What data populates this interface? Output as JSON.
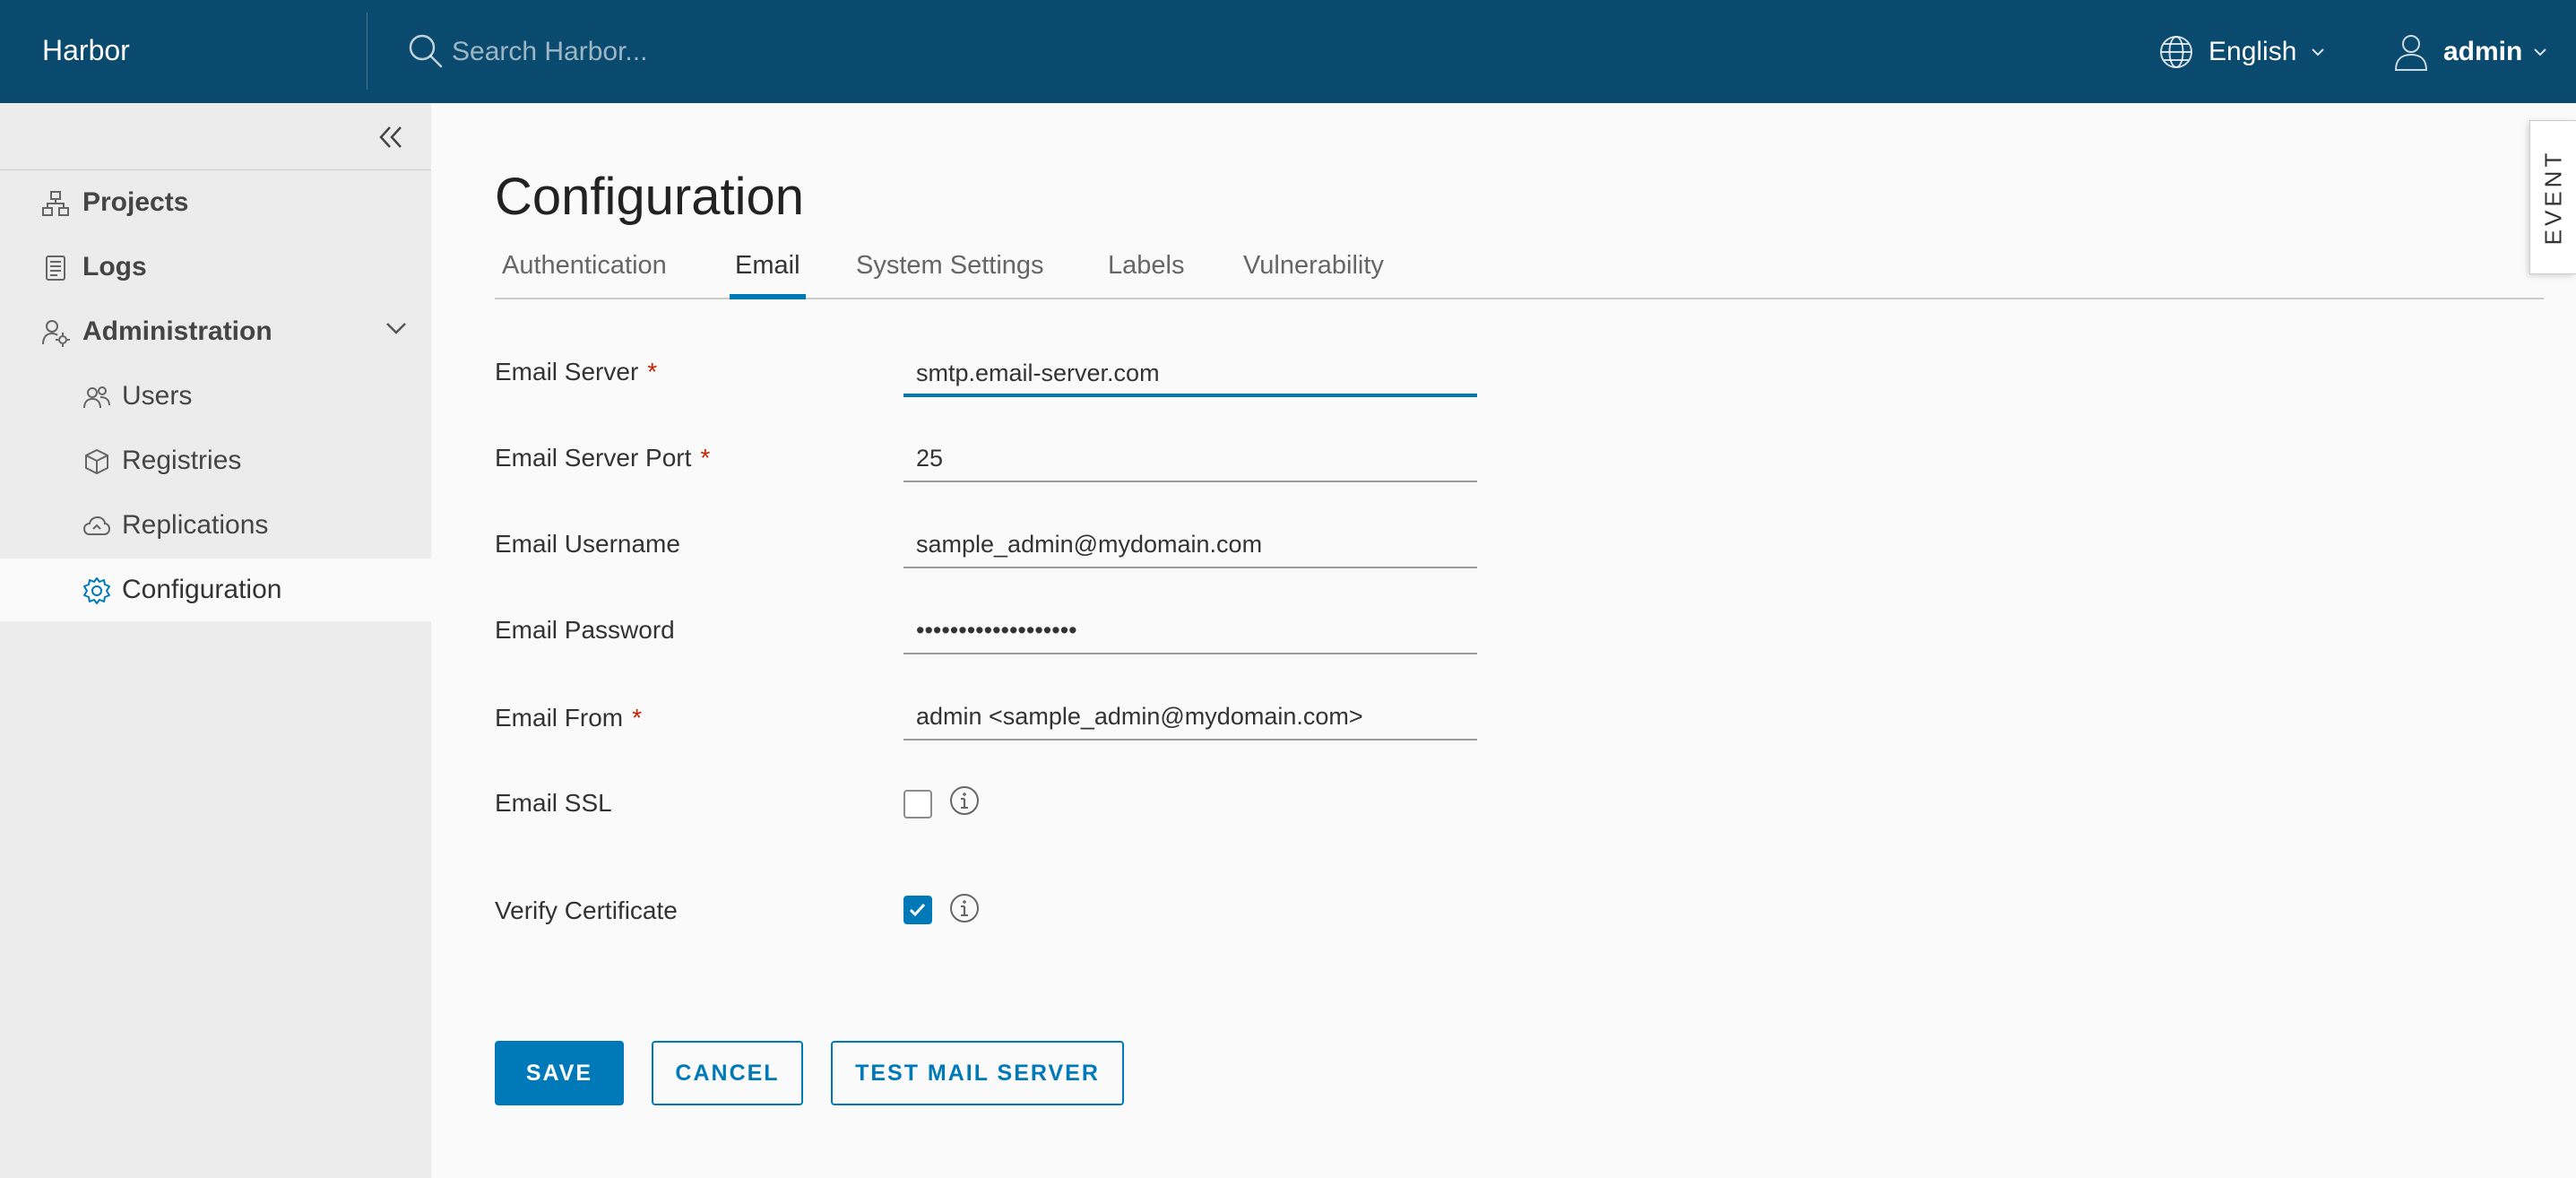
{
  "header": {
    "brand": "Harbor",
    "search_placeholder": "Search Harbor...",
    "language": "English",
    "user": "admin"
  },
  "sidebar": {
    "items": [
      {
        "label": "Projects",
        "icon": "projects-icon"
      },
      {
        "label": "Logs",
        "icon": "logs-icon"
      },
      {
        "label": "Administration",
        "icon": "administration-icon",
        "expanded": true
      },
      {
        "label": "Users",
        "icon": "users-icon"
      },
      {
        "label": "Registries",
        "icon": "registries-icon"
      },
      {
        "label": "Replications",
        "icon": "replications-icon"
      },
      {
        "label": "Configuration",
        "icon": "configuration-icon",
        "active": true
      }
    ]
  },
  "page": {
    "title": "Configuration",
    "tabs": [
      "Authentication",
      "Email",
      "System Settings",
      "Labels",
      "Vulnerability"
    ],
    "active_tab": "Email"
  },
  "form": {
    "email_server": {
      "label": "Email Server",
      "required_mark": "*",
      "value": "smtp.email-server.com"
    },
    "email_server_port": {
      "label": "Email Server Port",
      "required_mark": "*",
      "value": "25"
    },
    "email_username": {
      "label": "Email Username",
      "value": "sample_admin@mydomain.com"
    },
    "email_password": {
      "label": "Email Password",
      "value": "•••••••••••••••••••"
    },
    "email_from": {
      "label": "Email From",
      "required_mark": "*",
      "value": "admin <sample_admin@mydomain.com>"
    },
    "email_ssl": {
      "label": "Email SSL",
      "checked": false
    },
    "verify_certificate": {
      "label": "Verify Certificate",
      "checked": true
    }
  },
  "buttons": {
    "save": "SAVE",
    "cancel": "CANCEL",
    "test": "TEST MAIL SERVER"
  },
  "event_tab": "EVENT",
  "colors": {
    "header_bg": "#0a4a6e",
    "accent": "#0079b8",
    "required": "#c92100"
  }
}
